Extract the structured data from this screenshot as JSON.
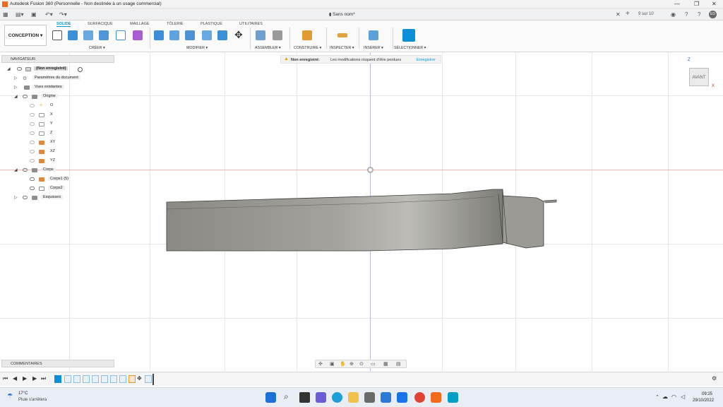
{
  "window": {
    "title": "Autodesk Fusion 360 (Personnelle - Non destinée à un usage commercial)",
    "minimize": "—",
    "maximize": "❐",
    "close": "✕"
  },
  "document": {
    "tab_title": "Sans nom*",
    "job_status": "9 sur 10",
    "user_initials": "ED"
  },
  "toolbar": {
    "workspace": "CONCEPTION ▾",
    "tabs": [
      "SOLIDE",
      "SURFACIQUE",
      "MAILLAGE",
      "TÔLERIE",
      "PLASTIQUE",
      "UTILITAIRES"
    ],
    "groups": {
      "create": "CRÉER ▾",
      "modify": "MODIFIER ▾",
      "assemble": "ASSEMBLER ▾",
      "construct": "CONSTRUIRE ▾",
      "inspect": "INSPECTER ▾",
      "insert": "INSÉRER ▾",
      "select": "SÉLECTIONNER ▾"
    }
  },
  "navigator": {
    "title": "NAVIGATEUR",
    "items": [
      {
        "label": "(Non enregistré)"
      },
      {
        "label": "Paramètres du document"
      },
      {
        "label": "Vues existantes"
      },
      {
        "label": "Origine"
      },
      {
        "label": "O"
      },
      {
        "label": "X"
      },
      {
        "label": "Y"
      },
      {
        "label": "Z"
      },
      {
        "label": "XY"
      },
      {
        "label": "XZ"
      },
      {
        "label": "YZ"
      },
      {
        "label": "Corps"
      },
      {
        "label": "Corps1 (5)"
      },
      {
        "label": "Corps2"
      },
      {
        "label": "Esquisses"
      }
    ]
  },
  "banner": {
    "status": "Non enregistré:",
    "message": "Les modifications risquent d'être perdues",
    "action": "Enregistrer"
  },
  "viewcube": {
    "face": "AVANT",
    "axis_z": "Z",
    "axis_x": "X"
  },
  "comments": {
    "title": "COMMENTAIRES"
  },
  "taskbar": {
    "temperature": "17°C",
    "weather": "Pluie s'arrêtera",
    "time": "09:25",
    "date": "29/10/2022"
  }
}
